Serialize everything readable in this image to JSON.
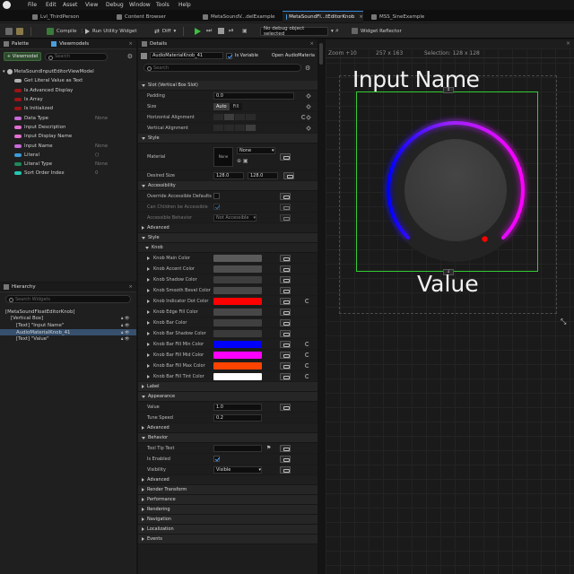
{
  "menu": {
    "items": [
      "File",
      "Edit",
      "Asset",
      "View",
      "Debug",
      "Window",
      "Tools",
      "Help"
    ]
  },
  "tabs": [
    {
      "label": "Lvl_ThirdPerson"
    },
    {
      "label": "Content Browser"
    },
    {
      "label": "MetaSoundV...delExample"
    },
    {
      "label": "MetaSoundFl...tEditorKnob"
    },
    {
      "label": "MSS_SineExample"
    }
  ],
  "toolbar": {
    "compile": "Compile",
    "run_utility": "Run Utility Widget",
    "diff": "Diff",
    "debug_object": "No debug object selected",
    "widget_reflector": "Widget Reflector"
  },
  "palette": {
    "title": "Palette"
  },
  "viewmodels": {
    "title": "Viewmodels",
    "add_button": "+ Viewmodel",
    "search_placeholder": "Search",
    "root": "MetaSoundInputEditorViewModel",
    "items": [
      {
        "label": "Get Literal Value as Text",
        "color": "#b0b0b0",
        "value": ""
      },
      {
        "label": "Is Advanced Display",
        "color": "#9c1414",
        "value": ""
      },
      {
        "label": "Is Array",
        "color": "#9c1414",
        "value": ""
      },
      {
        "label": "Is Initialized",
        "color": "#9c1414",
        "value": ""
      },
      {
        "label": "Data Type",
        "color": "#c86ad8",
        "value": "None"
      },
      {
        "label": "Input Description",
        "color": "#e26fd2",
        "value": ""
      },
      {
        "label": "Input Display Name",
        "color": "#e26fd2",
        "value": ""
      },
      {
        "label": "Input Name",
        "color": "#c86ad8",
        "value": "None"
      },
      {
        "label": "Literal",
        "color": "#3d9bd8",
        "value": "()"
      },
      {
        "label": "Literal Type",
        "color": "#1f8a5a",
        "value": "None"
      },
      {
        "label": "Sort Order Index",
        "color": "#25c6b0",
        "value": "0"
      }
    ]
  },
  "hierarchy": {
    "title": "Hierarchy",
    "search_placeholder": "Search Widgets",
    "items": [
      {
        "label": "[MetaSoundFloatEditorKnob]",
        "indent": 0
      },
      {
        "label": "[Vertical Box]",
        "indent": 1
      },
      {
        "label": "[Text] \"Input Name\"",
        "indent": 2
      },
      {
        "label": "AudioMaterialKnob_41",
        "indent": 2
      },
      {
        "label": "[Text] \"Value\"",
        "indent": 2
      }
    ]
  },
  "details": {
    "title": "Details",
    "widget_name": "AudioMaterialKnob_41",
    "is_variable": "Is Variable",
    "open_link": "Open AudioMateria",
    "search_placeholder": "Search",
    "slot_section": "Slot (Vertical Box Slot)",
    "padding_label": "Padding",
    "padding_value": "0.0",
    "size_label": "Size",
    "size_auto": "Auto",
    "size_fill": "Fill",
    "halign_label": "Horizontal Alignment",
    "valign_label": "Vertical Alignment",
    "style_section": "Style",
    "material_label": "Material",
    "material_thumb": "None",
    "material_value": "None",
    "desired_size_label": "Desired Size",
    "desired_w": "128.0",
    "desired_h": "128.0",
    "accessibility_section": "Accessibility",
    "override_label": "Override Accessible Defaults",
    "can_children_label": "Can Children be Accessible",
    "behavior_label": "Accessible Behavior",
    "behavior_value": "Not Accessible",
    "advanced": "Advanced",
    "style2_section": "Style",
    "knob_section": "Knob",
    "colors": [
      {
        "label": "Knob Main Color",
        "color": "#5a5a5a"
      },
      {
        "label": "Knob Accent Color",
        "color": "#4e4e4e"
      },
      {
        "label": "Knob Shadow Color",
        "color": "#3e3e3e"
      },
      {
        "label": "Knob Smooth Bevel Color",
        "color": "#484848"
      },
      {
        "label": "Knob Indicator Dot Color",
        "color": "#ff0000"
      },
      {
        "label": "Knob Edge Fill Color",
        "color": "#474747"
      },
      {
        "label": "Knob Bar Color",
        "color": "#404040"
      },
      {
        "label": "Knob Bar Shadow Color",
        "color": "#3a3a3a"
      },
      {
        "label": "Knob Bar Fill Min Color",
        "color": "#0000ff"
      },
      {
        "label": "Knob Bar Fill Mid Color",
        "color": "#ff00ff"
      },
      {
        "label": "Knob Bar Fill Max Color",
        "color": "#ff4400"
      },
      {
        "label": "Knob Bar Fill Tint Color",
        "color": "#ffffff"
      }
    ],
    "label_section": "Label",
    "appearance_section": "Appearance",
    "value_label": "Value",
    "value_value": "1.0",
    "tune_label": "Tune Speed",
    "tune_value": "0.2",
    "advanced2": "Advanced",
    "behavior_section": "Behavior",
    "tooltip_label": "Tool Tip Text",
    "enabled_label": "Is Enabled",
    "visibility_label": "Visibility",
    "visibility_value": "Visible",
    "advanced3": "Advanced",
    "collapsed": [
      "Render Transform",
      "Performance",
      "Rendering",
      "Navigation",
      "Localization",
      "Events"
    ]
  },
  "viewport": {
    "zoom": "Zoom +10",
    "size": "257 x 163",
    "selection": "Selection: 128 x 128",
    "input_name": "Input Name",
    "value": "Value",
    "knob_value": 1.0,
    "colors": {
      "bar_min": "#0000ff",
      "bar_mid": "#ff00ff",
      "bar_max": "#ff4400",
      "dot": "#ff0000",
      "selection": "#33cc33"
    }
  }
}
